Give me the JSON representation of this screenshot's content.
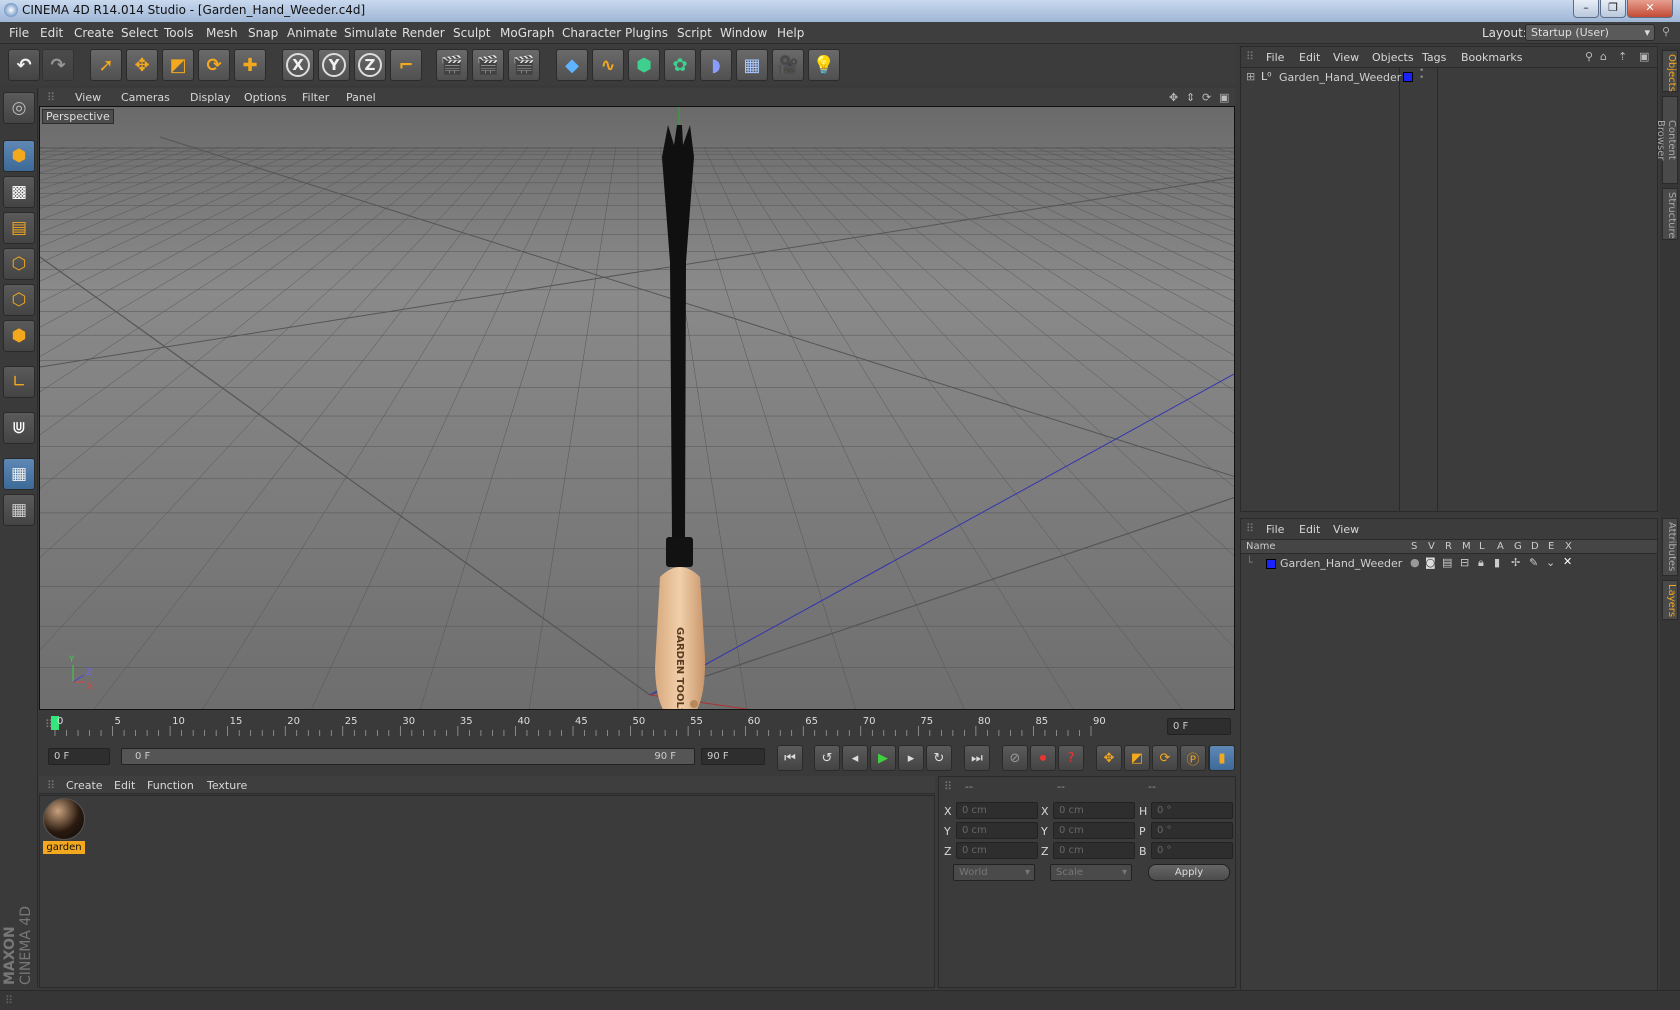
{
  "window": {
    "title": "CINEMA 4D R14.014 Studio - [Garden_Hand_Weeder.c4d]",
    "buttons": [
      "–",
      "❐",
      "✕"
    ]
  },
  "menubar": {
    "items": [
      "File",
      "Edit",
      "Create",
      "Select",
      "Tools",
      "Mesh",
      "Snap",
      "Animate",
      "Simulate",
      "Render",
      "Sculpt",
      "MoGraph",
      "Character",
      "Plugins",
      "Script",
      "Window",
      "Help"
    ],
    "layout_label": "Layout:",
    "layout_value": "Startup (User)"
  },
  "toolbar": {
    "tools": [
      "undo",
      "redo",
      "live-selection",
      "move",
      "scale",
      "rotate",
      "add",
      "x-axis",
      "y-axis",
      "z-axis",
      "coordinate-system",
      "render-view",
      "render-picture-viewer",
      "render-settings",
      "cube",
      "spline-pen",
      "nurbs",
      "array",
      "deformer",
      "floor",
      "camera",
      "light"
    ],
    "axis_labels": {
      "x": "X",
      "y": "Y",
      "z": "Z"
    }
  },
  "viewport": {
    "menu": [
      "View",
      "Cameras",
      "Display",
      "Options",
      "Filter",
      "Panel"
    ],
    "label": "Perspective",
    "axis_gizmo": {
      "y": "Y",
      "z": "Z",
      "x": "X"
    },
    "handle_text": "GARDEN TOOLS"
  },
  "timeline": {
    "ticks": [
      "0",
      "5",
      "10",
      "15",
      "20",
      "25",
      "30",
      "35",
      "40",
      "45",
      "50",
      "55",
      "60",
      "65",
      "70",
      "75",
      "80",
      "85",
      "90"
    ],
    "current_frame": "0 F"
  },
  "transport": {
    "start_frame": "0 F",
    "range_start": "0 F",
    "range_end": "90 F",
    "end_frame": "90 F"
  },
  "material_manager": {
    "menu": [
      "Create",
      "Edit",
      "Function",
      "Texture"
    ],
    "materials": [
      {
        "name": "garden"
      }
    ]
  },
  "coordinates": {
    "headers": [
      "--",
      "--",
      "--"
    ],
    "rows": [
      {
        "a": "X",
        "a_val": "0 cm",
        "b": "X",
        "b_val": "0 cm",
        "c": "H",
        "c_val": "0 °"
      },
      {
        "a": "Y",
        "a_val": "0 cm",
        "b": "Y",
        "b_val": "0 cm",
        "c": "P",
        "c_val": "0 °"
      },
      {
        "a": "Z",
        "a_val": "0 cm",
        "b": "Z",
        "b_val": "0 cm",
        "c": "B",
        "c_val": "0 °"
      }
    ],
    "space": "World",
    "mode": "Scale",
    "apply": "Apply"
  },
  "object_manager": {
    "menu": [
      "File",
      "Edit",
      "View",
      "Objects",
      "Tags",
      "Bookmarks"
    ],
    "objects": [
      {
        "name": "Garden_Hand_Weeder",
        "layer_color": "#1a22ff"
      }
    ]
  },
  "layer_manager": {
    "menu": [
      "File",
      "Edit",
      "View"
    ],
    "columns": [
      "Name",
      "S",
      "V",
      "R",
      "M",
      "L",
      "A",
      "G",
      "D",
      "E",
      "X"
    ],
    "layers": [
      {
        "name": "Garden_Hand_Weeder",
        "color": "#1a22ff"
      }
    ]
  },
  "right_tabs": [
    "Objects",
    "Content Browser",
    "Structure",
    "Attributes",
    "Layers"
  ],
  "logo": {
    "line1": "MAXON",
    "line2": "CINEMA 4D"
  },
  "colors": {
    "accent": "#f3a81e",
    "grid_x": "#3434b0",
    "grid_z": "#b03030"
  }
}
